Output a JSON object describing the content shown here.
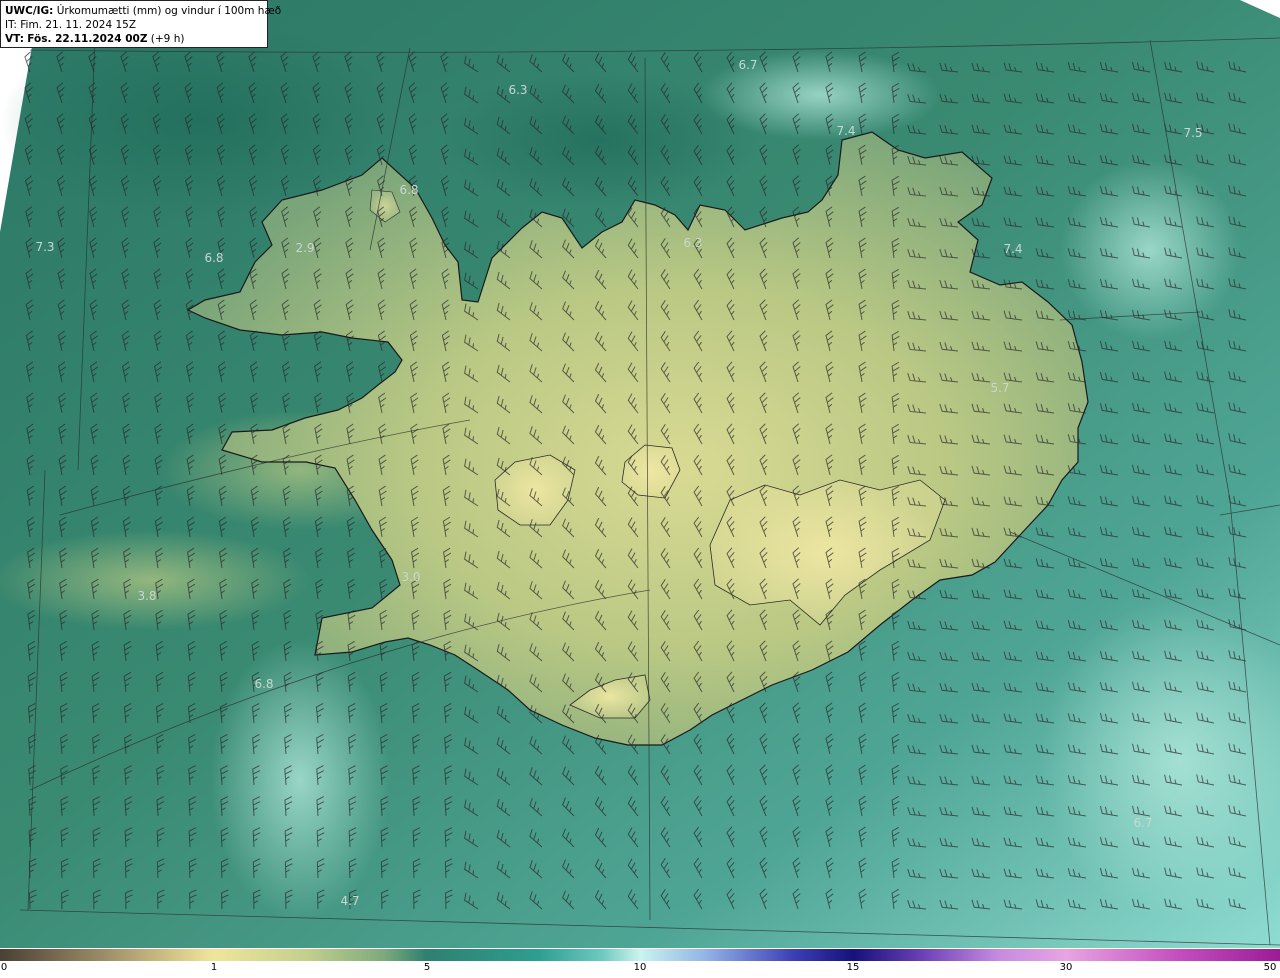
{
  "header": {
    "model": "UWC/IG:",
    "title": "Úrkomumætti (mm) og vindur í 100m hæð",
    "it_label": "IT:",
    "it_value": "Fim. 21. 11. 2024 15Z",
    "vt_label": "VT:",
    "vt_value": "Fös. 22.11.2024 00Z",
    "vt_offset": "(+9 h)"
  },
  "map_values": [
    "6.7",
    "6.3",
    "7.4",
    "7.5",
    "6.8",
    "7.3",
    "6.8",
    "2.9",
    "6.3",
    "7.4",
    "5.7",
    "3.0",
    "3.8",
    "6.8",
    "4.7",
    "6.7"
  ],
  "colorbar": {
    "ticks": [
      "0",
      "1",
      "5",
      "10",
      "15",
      "30",
      "50"
    ]
  },
  "colors": {
    "ocean": "#2d7d6c",
    "ocean_light": "#6cc4b7",
    "land_low": "#8fb37c",
    "land_high": "#d6d68f",
    "coast": "#1a1a1a"
  }
}
